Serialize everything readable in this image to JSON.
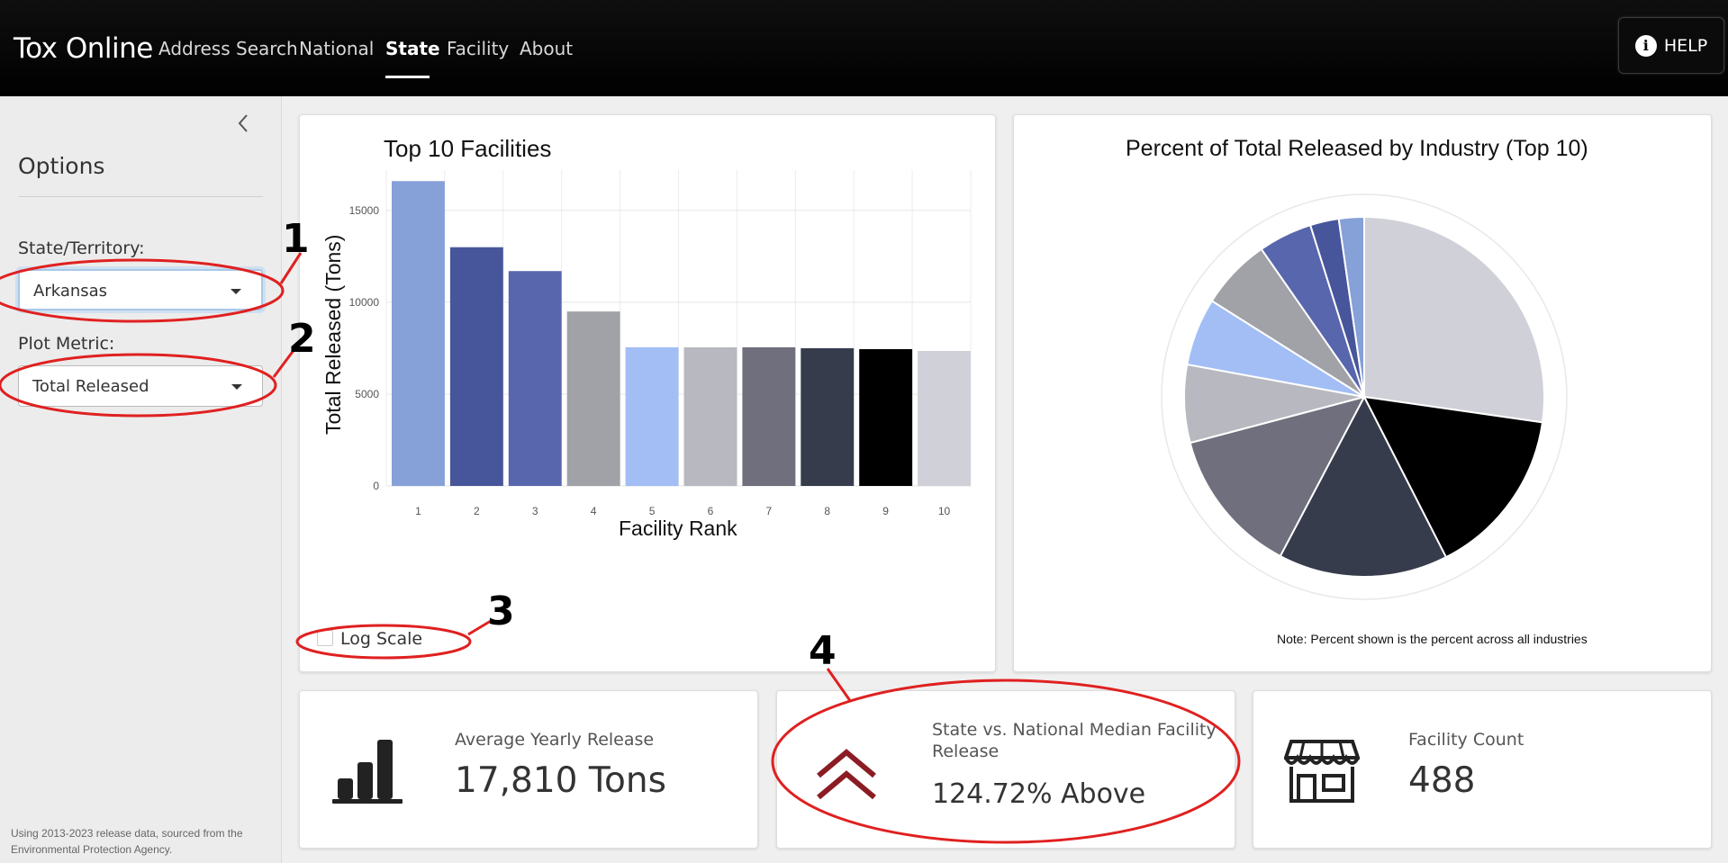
{
  "navbar": {
    "brand": "Tox Online",
    "items": [
      {
        "label": "Address Search",
        "active": false
      },
      {
        "label": "National",
        "active": false
      },
      {
        "label": "State",
        "active": true
      },
      {
        "label": "Facility",
        "active": false
      },
      {
        "label": "About",
        "active": false
      }
    ],
    "help_label": "HELP"
  },
  "sidebar": {
    "collapse_icon": "chevron-left-icon",
    "title": "Options",
    "state_label": "State/Territory:",
    "state_value": "Arkansas",
    "metric_label": "Plot Metric:",
    "metric_value": "Total Released",
    "footnote": "Using 2013-2023 release data, sourced from the Environmental Protection Agency."
  },
  "bar_card": {
    "log_scale_label": "Log Scale",
    "log_scale_checked": false
  },
  "pie_card": {
    "note": "Note: Percent shown is the percent across all industries"
  },
  "stats": [
    {
      "label": "Average Yearly Release",
      "value": "17,810 Tons",
      "icon": "bar-chart-icon"
    },
    {
      "label": "State vs. National Median Facility Release",
      "value": "124.72% Above",
      "icon": "double-chevron-up-icon",
      "icon_color": "#8b1c24"
    },
    {
      "label": "Facility Count",
      "value": "488",
      "icon": "storefront-icon"
    }
  ],
  "annotations": [
    "1",
    "2",
    "3",
    "4"
  ],
  "annotation_color": "#e02020",
  "chart_data": [
    {
      "type": "bar",
      "title": "Top 10 Facilities",
      "xlabel": "Facility Rank",
      "ylabel": "Total Released (Tons)",
      "categories": [
        "1",
        "2",
        "3",
        "4",
        "5",
        "6",
        "7",
        "8",
        "9",
        "10"
      ],
      "values": [
        16600,
        13000,
        11700,
        9500,
        7550,
        7550,
        7550,
        7500,
        7450,
        7350
      ],
      "colors": [
        "#86a0d8",
        "#47559a",
        "#5866ad",
        "#a1a1a8",
        "#a2bef5",
        "#b8b8c0",
        "#6f6f7d",
        "#373c4d",
        "#000000",
        "#d0d0d8"
      ],
      "yticks": [
        0,
        5000,
        10000,
        15000
      ],
      "ylim": [
        0,
        17200
      ],
      "grid": true
    },
    {
      "type": "pie",
      "title": "Percent of Total Released by Industry (Top 10)",
      "values": [
        26.5,
        14.8,
        14.8,
        12.8,
        6.8,
        5.9,
        6.2,
        4.7,
        2.5,
        2.2
      ],
      "colors": [
        "#d0d0d8",
        "#000000",
        "#373c4d",
        "#6f6f7d",
        "#b8b8c0",
        "#a2bef5",
        "#a1a1a8",
        "#5866ad",
        "#47559a",
        "#86a0d8"
      ],
      "legend": false
    }
  ]
}
